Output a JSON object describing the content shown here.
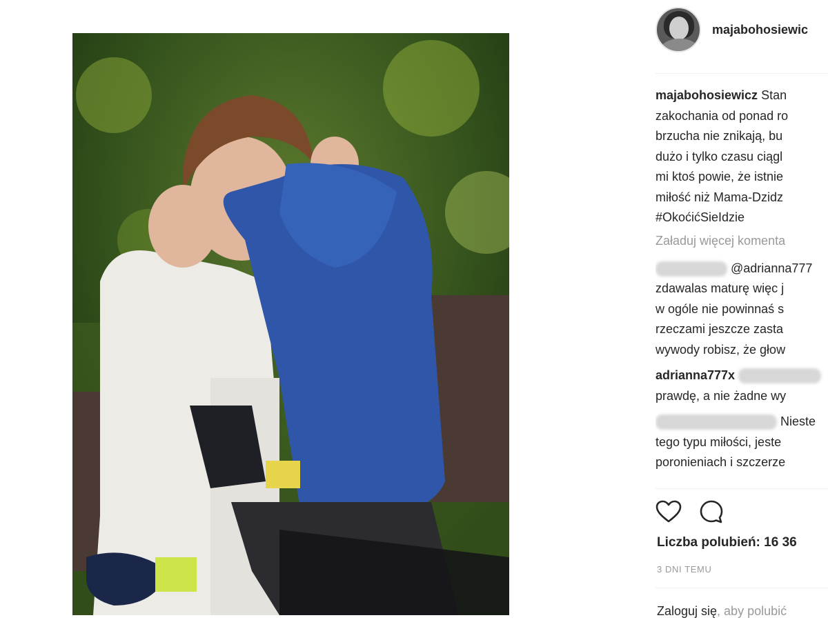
{
  "post": {
    "username": "majabohosiewic",
    "caption_user": "majabohosiewicz",
    "caption_lines": [
      "Stan",
      "zakochania od ponad ro",
      "brzucha nie znikają, bu",
      "dużo i tylko czasu ciągl",
      "mi ktoś powie, że istnie",
      "miłość niż Mama-Dzidz",
      "#OkoćićSieIdzie"
    ],
    "load_more": "Załaduj więcej komenta",
    "comments": [
      {
        "user": "",
        "lines": [
          "@adrianna777",
          "zdawalas maturę więc j",
          "w ogóle nie powinnaś s",
          "rzeczami jeszcze zasta",
          "wywody robisz, że głow"
        ]
      },
      {
        "user": "adrianna777x",
        "lines": [
          "",
          "prawdę, a nie żadne wy"
        ]
      },
      {
        "user": "",
        "lines": [
          "Nieste",
          "tego typu miłości, jeste",
          "poronieniach i szczerze"
        ]
      }
    ],
    "likes": "Liczba polubień: 16 36",
    "time": "3 DNI TEMU",
    "login_link": "Zaloguj się",
    "login_rest": ", aby polubić"
  },
  "icons": {
    "like": "heart-icon",
    "comment": "comment-icon"
  },
  "colors": {
    "text": "#262626",
    "muted": "#999999",
    "divider": "#efefef"
  }
}
